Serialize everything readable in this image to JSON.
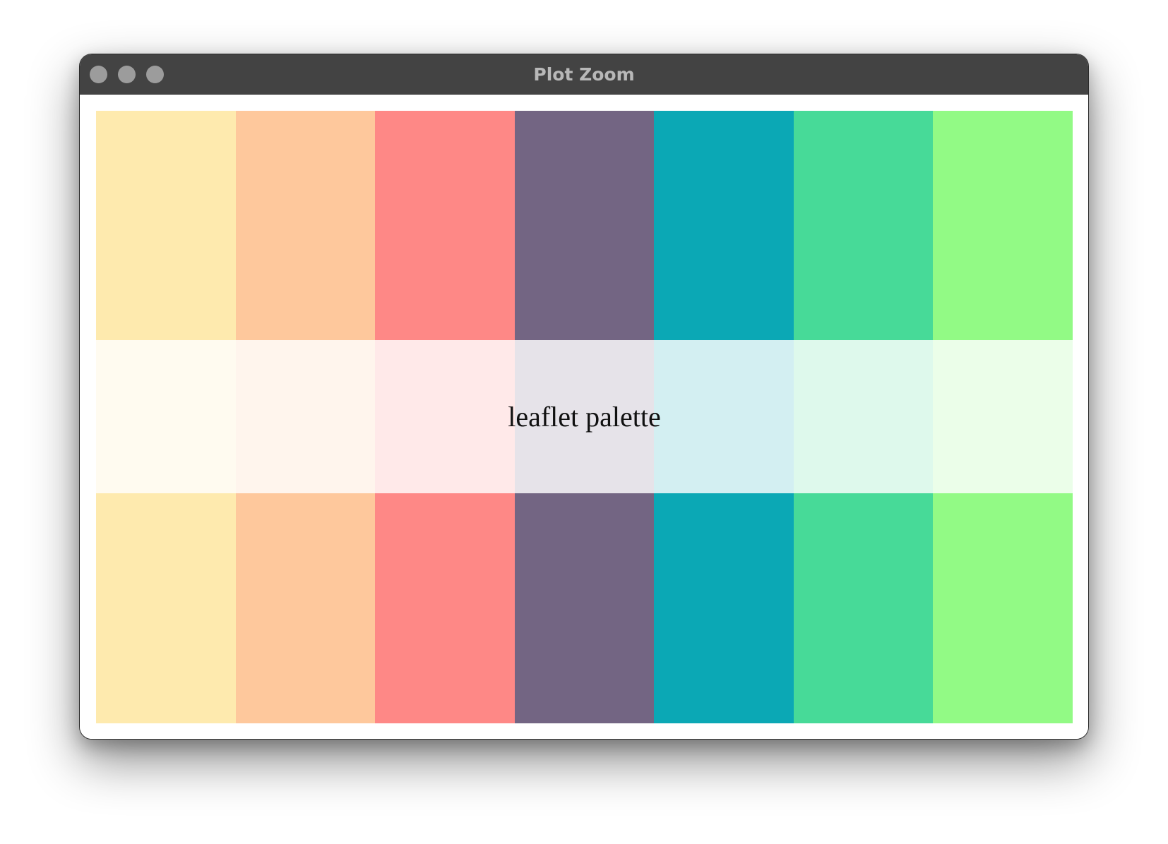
{
  "window": {
    "title": "Plot Zoom"
  },
  "plot": {
    "label": "leaflet palette",
    "colors": [
      "#FEEAAE",
      "#FEC89C",
      "#FE8886",
      "#736583",
      "#0BA8B5",
      "#47DA98",
      "#92FA85"
    ]
  }
}
